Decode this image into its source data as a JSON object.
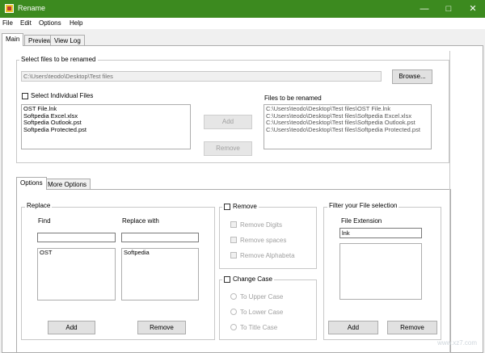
{
  "window": {
    "title": "Rename"
  },
  "menu": {
    "items": [
      "File",
      "Edit",
      "Options",
      "Help"
    ]
  },
  "main_tabs": [
    "Main",
    "Preview",
    "View Log"
  ],
  "select_files": {
    "group_label": "Select files to be renamed",
    "path_value": "C:\\Users\\teodo\\Desktop\\Test files",
    "browse_label": "Browse...",
    "individual_label": "Select Individual Files",
    "left_list": [
      "OST File.lnk",
      "Softpedia Excel.xlsx",
      "Softpedia Outlook.pst",
      "Softpedia Protected.pst"
    ],
    "add_label": "Add",
    "remove_label": "Remove",
    "right_label": "Files to be renamed",
    "right_list": [
      "C:\\Users\\teodo\\Desktop\\Test files\\OST File.lnk",
      "C:\\Users\\teodo\\Desktop\\Test files\\Softpedia Excel.xlsx",
      "C:\\Users\\teodo\\Desktop\\Test files\\Softpedia Outlook.pst",
      "C:\\Users\\teodo\\Desktop\\Test files\\Softpedia Protected.pst"
    ]
  },
  "options_tabs": [
    "Options",
    "More Options"
  ],
  "replace": {
    "group_label": "Replace",
    "find_label": "Find",
    "replace_label": "Replace with",
    "find_list": [
      "OST"
    ],
    "replace_list": [
      "Softpedia"
    ],
    "add_label": "Add",
    "remove_label": "Remove"
  },
  "remove": {
    "label": "Remove",
    "options": [
      "Remove Digits",
      "Remove spaces",
      "Remove Alphabeta"
    ]
  },
  "change_case": {
    "label": "Change Case",
    "options": [
      "To Upper Case",
      "To Lower Case",
      "To Title Case"
    ]
  },
  "filter": {
    "group_label": "Filter your File selection",
    "ext_label": "File Extension",
    "ext_value": "lnk",
    "add_label": "Add",
    "remove_label": "Remove"
  },
  "watermark": "www.xz7.com"
}
